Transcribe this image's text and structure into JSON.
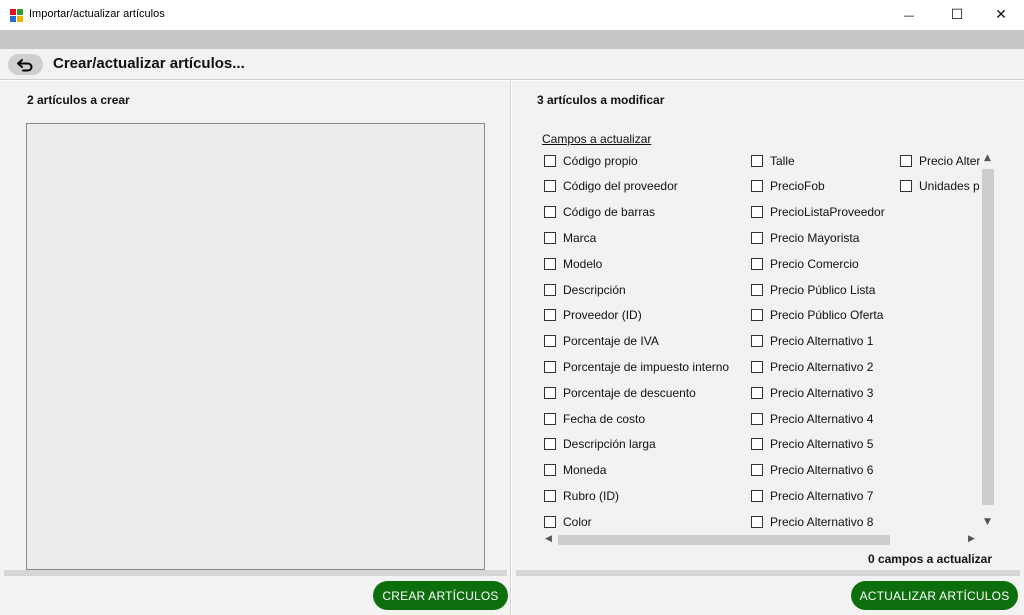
{
  "window": {
    "title": "Importar/actualizar artículos",
    "minimize_glyph": "—",
    "maximize_glyph": "☐",
    "close_glyph": "✕"
  },
  "header": {
    "title": "Crear/actualizar artículos...",
    "back_icon": "undo-arrow-icon"
  },
  "left_panel": {
    "title": "2 artículos a crear",
    "button_label": "CREAR ARTÍCULOS"
  },
  "right_panel": {
    "title": "3 artículos a modificar",
    "fields_label": "Campos a actualizar",
    "columns": [
      [
        "Código propio",
        "Código del proveedor",
        "Código de barras",
        "Marca",
        "Modelo",
        "Descripción",
        "Proveedor (ID)",
        "Porcentaje de IVA",
        "Porcentaje de impuesto interno",
        "Porcentaje de descuento",
        "Fecha de costo",
        "Descripción larga",
        "Moneda",
        "Rubro (ID)",
        "Color"
      ],
      [
        "Talle",
        "PrecioFob",
        "PrecioListaProveedor",
        "Precio Mayorista",
        "Precio Comercio",
        "Precio Público Lista",
        "Precio Público Oferta",
        "Precio Alternativo 1",
        "Precio Alternativo 2",
        "Precio Alternativo 3",
        "Precio Alternativo 4",
        "Precio Alternativo 5",
        "Precio Alternativo 6",
        "Precio Alternativo 7",
        "Precio Alternativo 8"
      ],
      [
        "Precio Alter",
        "Unidades p"
      ]
    ],
    "count_label": "0 campos a actualizar",
    "button_label": "ACTUALIZAR ARTÍCULOS"
  },
  "colors": {
    "accent_green": "#0d6e0d",
    "panel_bg": "#f2f2f2"
  }
}
